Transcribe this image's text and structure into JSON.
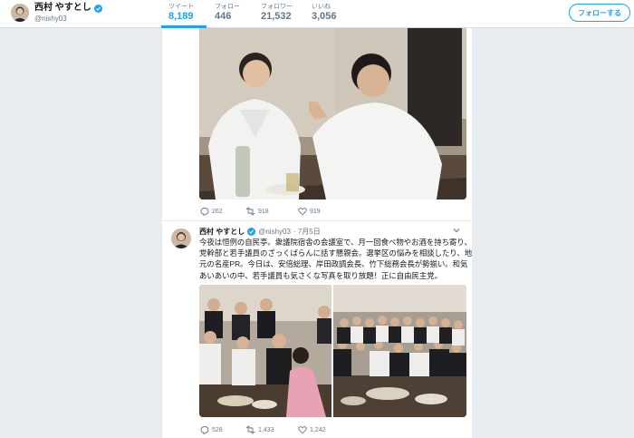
{
  "profile": {
    "display_name": "西村 やすとし",
    "handle": "@nishy03",
    "follow_button": "フォローする"
  },
  "stats": [
    {
      "label": "ツイート",
      "value": "8,189",
      "active": true
    },
    {
      "label": "フォロー",
      "value": "446",
      "active": false
    },
    {
      "label": "フォロワー",
      "value": "21,532",
      "active": false
    },
    {
      "label": "いいね",
      "value": "3,056",
      "active": false
    }
  ],
  "tweet1": {
    "replies": "262",
    "retweets": "918",
    "likes": "919"
  },
  "tweet2": {
    "name": "西村 やすとし",
    "handle": "@nishy03",
    "date": "· 7月5日",
    "text_lines": [
      "今夜は恒例の自民亭。衆議院宿舎の会議室で、月一回食べ物やお酒を持ち寄り、",
      "党幹部と若手議員のざっくばらんに話す懇親会。選挙区の悩みを相談したり、地",
      "元の名産PR。今日は、安倍総理、岸田政調会長、竹下総務会長が勢揃い。和気",
      "あいあいの中、若手議員も気さくな写真を取り放題！正に自由民主党。"
    ],
    "replies": "528",
    "retweets": "1,433",
    "likes": "1,242"
  },
  "colors": {
    "accent": "#1da1f2",
    "background": "#e6ecf0",
    "muted_text": "#657786"
  },
  "icons": [
    "verified-badge-icon",
    "reply-icon",
    "retweet-icon",
    "like-icon",
    "chevron-down-icon"
  ]
}
